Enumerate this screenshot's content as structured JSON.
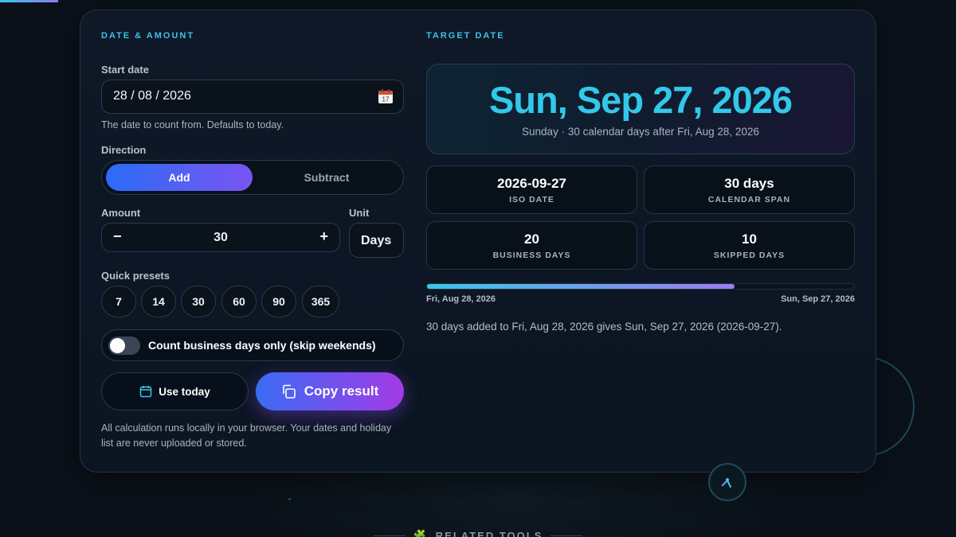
{
  "left": {
    "section_title": "DATE & AMOUNT",
    "start_date": {
      "label": "Start date",
      "value": "28 / 08 / 2026",
      "icon": "calendar-icon",
      "hint": "The date to count from. Defaults to today."
    },
    "direction": {
      "label": "Direction",
      "options": [
        "Add",
        "Subtract"
      ],
      "selected": "Add"
    },
    "amount": {
      "label": "Amount",
      "value": "30",
      "minus": "−",
      "plus": "+"
    },
    "unit": {
      "label": "Unit",
      "value": "Days"
    },
    "presets": {
      "label": "Quick presets",
      "values": [
        "7",
        "14",
        "30",
        "60",
        "90",
        "365"
      ]
    },
    "business_toggle": {
      "label": "Count business days only (skip weekends)",
      "checked": false
    },
    "use_today_label": "Use today",
    "copy_label": "Copy result",
    "footnote": "All calculation runs locally in your browser. Your dates and holiday list are never uploaded or stored."
  },
  "right": {
    "section_title": "TARGET DATE",
    "result_date": "Sun, Sep 27, 2026",
    "result_sub": "Sunday · 30 calendar days after Fri, Aug 28, 2026",
    "stats": [
      {
        "value": "2026-09-27",
        "label": "ISO DATE"
      },
      {
        "value": "30 days",
        "label": "CALENDAR SPAN"
      },
      {
        "value": "20",
        "label": "BUSINESS DAYS"
      },
      {
        "value": "10",
        "label": "SKIPPED DAYS"
      }
    ],
    "progress": {
      "fraction": 0.72,
      "start_label": "Fri, Aug 28, 2026",
      "end_label": "Sun, Sep 27, 2026"
    },
    "summary": "30 days added to Fri, Aug 28, 2026 gives Sun, Sep 27, 2026 (2026-09-27)."
  },
  "footer": {
    "related_label": "RELATED TOOLS",
    "related_icon": "puzzle-icon"
  },
  "colors": {
    "accent": "#33c8ea",
    "add_gradient_start": "#2a6cf6",
    "add_gradient_end": "#7a55f2",
    "copy_gradient_end": "#a33ae6"
  }
}
